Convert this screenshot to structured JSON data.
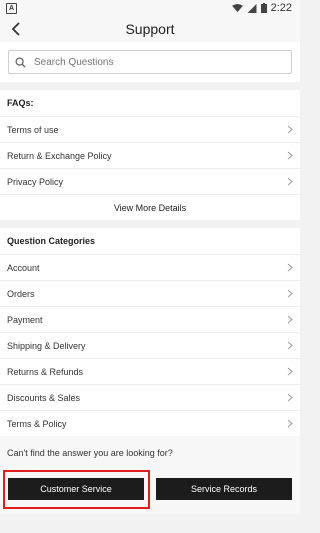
{
  "status_bar": {
    "notif_icon": "A",
    "time": "2:22"
  },
  "header": {
    "title": "Support",
    "back_icon": "chevron-left-icon"
  },
  "search": {
    "placeholder": "Search Questions",
    "icon": "search-icon"
  },
  "faqs": {
    "title": "FAQs:",
    "items": [
      {
        "label": "Terms of use"
      },
      {
        "label": "Return & Exchange Policy"
      },
      {
        "label": "Privacy Policy"
      }
    ],
    "view_more": "View More Details"
  },
  "categories": {
    "title": "Question Categories",
    "items": [
      {
        "label": "Account"
      },
      {
        "label": "Orders"
      },
      {
        "label": "Payment"
      },
      {
        "label": "Shipping & Delivery"
      },
      {
        "label": "Returns & Refunds"
      },
      {
        "label": "Discounts & Sales"
      },
      {
        "label": "Terms & Policy"
      }
    ]
  },
  "footer": {
    "prompt": "Can't find the answer you are looking for?",
    "customer_service": "Customer Service",
    "service_records": "Service Records"
  },
  "colors": {
    "button_bg": "#1c1c1c",
    "highlight": "#e02020",
    "background": "#f2f2f2"
  }
}
